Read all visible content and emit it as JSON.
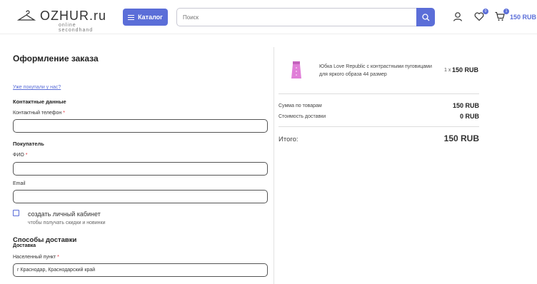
{
  "header": {
    "logo_text": "OZHUR.ru",
    "logo_sub": "online secondhand",
    "catalog_label": "Каталог",
    "search_placeholder": "Поиск",
    "favorites_count": "0",
    "cart_count": "1",
    "cart_total": "150 RUB"
  },
  "form": {
    "title": "Оформление заказа",
    "already_link": "Уже покупали у нас?",
    "contacts_section": "Контактные данные",
    "phone_label": "Контактный телефон",
    "phone_value": "",
    "buyer_section": "Покупатель",
    "fio_label": "ФИО",
    "fio_value": "",
    "email_label": "Email",
    "email_value": "",
    "create_account_label": "создать личный кабинет",
    "create_account_sub": "чтобы получать скидки и новинки",
    "delivery_title": "Способы доставки",
    "delivery_sub": "Доставка",
    "city_label": "Населенный пункт",
    "city_value": "г Краснодар, Краснодарский край",
    "required_mark": "*"
  },
  "summary": {
    "product_name": "Юбка Love Republic с контрастными пуговицами для яркого образа 44 размер",
    "quantity": "1 x",
    "price": "150 RUB",
    "goods_label": "Сумма по товарам",
    "goods_value": "150 RUB",
    "delivery_label": "Стоимость доставки",
    "delivery_value": "0 RUB",
    "total_label": "Итого:",
    "total_value": "150 RUB"
  },
  "colors": {
    "accent": "#5b6ed8",
    "required": "#e0303a",
    "product": "#e07fd8"
  },
  "icons": [
    "hanger-icon",
    "menu-icon",
    "search-icon",
    "user-icon",
    "heart-icon",
    "cart-icon",
    "skirt-icon"
  ]
}
